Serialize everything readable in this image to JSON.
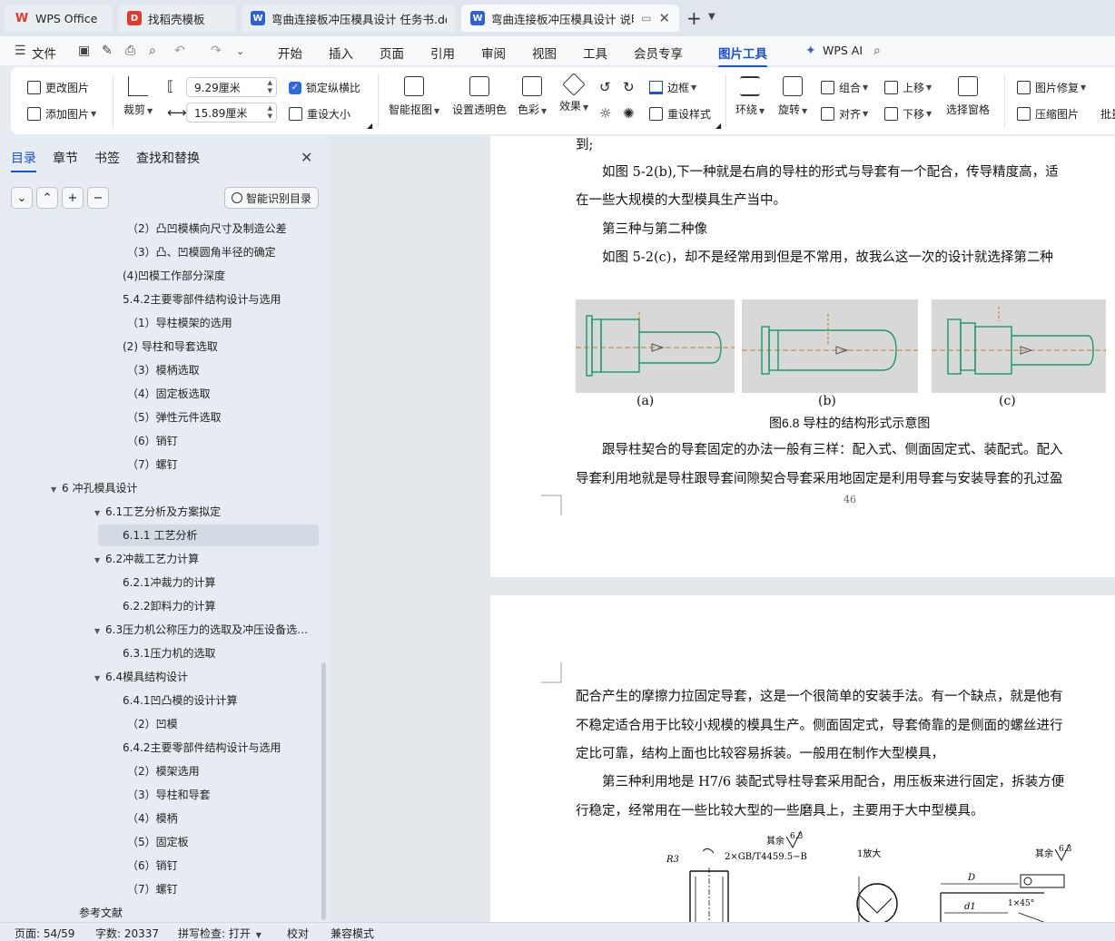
{
  "tabs": [
    {
      "label": "WPS Office",
      "icon": "wps-logo-icon"
    },
    {
      "label": "找稻壳模板",
      "icon": "template-icon"
    },
    {
      "label": "弯曲连接板冲压模具设计 任务书.doc",
      "icon": "writer-doc-icon"
    },
    {
      "label": "弯曲连接板冲压模具设计 说明",
      "icon": "writer-doc-icon"
    }
  ],
  "menu": {
    "file": "文件",
    "items": [
      "开始",
      "插入",
      "页面",
      "引用",
      "审阅",
      "视图",
      "工具",
      "会员专享",
      "图片工具"
    ],
    "active": "图片工具",
    "ai": "WPS AI"
  },
  "ribbon": {
    "change_picture": "更改图片",
    "add_picture": "添加图片",
    "crop": "裁剪",
    "height_value": "9.29厘米",
    "width_value": "15.89厘米",
    "lock_ratio": "锁定纵横比",
    "reset_size": "重设大小",
    "smart_cutout": "智能抠图",
    "set_transparent": "设置透明色",
    "color": "色彩",
    "effect": "效果",
    "border": "边框",
    "reset_style": "重设样式",
    "wrap": "环绕",
    "rotate": "旋转",
    "group": "组合",
    "align": "对齐",
    "move_up": "上移",
    "move_down": "下移",
    "selection_pane": "选择窗格",
    "picture_repair": "图片修复",
    "compress": "压缩图片",
    "batch": "批量"
  },
  "sidebar": {
    "tabs": [
      "目录",
      "章节",
      "书签",
      "查找和替换"
    ],
    "active_tab": "目录",
    "smart_toc": "智能识别目录",
    "toc": [
      {
        "text": "（2）凸凹模横向尺寸及制造公差",
        "level": 3
      },
      {
        "text": "（3）凸、凹模圆角半径的确定",
        "level": 3
      },
      {
        "text": "(4)凹模工作部分深度",
        "level": 2
      },
      {
        "text": "5.4.2主要零部件结构设计与选用",
        "level": 2
      },
      {
        "text": "（1）导柱模架的选用",
        "level": 3
      },
      {
        "text": "(2) 导柱和导套选取",
        "level": 2
      },
      {
        "text": "（3）模柄选取",
        "level": 3
      },
      {
        "text": "（4）固定板选取",
        "level": 3
      },
      {
        "text": "（5）弹性元件选取",
        "level": 3
      },
      {
        "text": "（6）销钉",
        "level": 3
      },
      {
        "text": "（7）螺钉",
        "level": 3
      },
      {
        "text": "6 冲孔模具设计",
        "level": 0,
        "expanded": true
      },
      {
        "text": "6.1工艺分析及方案拟定",
        "level": 1,
        "expanded": true
      },
      {
        "text": "6.1.1 工艺分析",
        "level": 2,
        "selected": true
      },
      {
        "text": "6.2冲裁工艺力计算",
        "level": 1,
        "expanded": true
      },
      {
        "text": "6.2.1冲裁力的计算",
        "level": 2
      },
      {
        "text": "6.2.2卸料力的计算",
        "level": 2
      },
      {
        "text": "6.3压力机公称压力的选取及冲压设备选…",
        "level": 1,
        "expanded": true
      },
      {
        "text": "6.3.1压力机的选取",
        "level": 2
      },
      {
        "text": "6.4模具结构设计",
        "level": 1,
        "expanded": true
      },
      {
        "text": "6.4.1凹凸模的设计计算",
        "level": 2
      },
      {
        "text": "（2）凹模",
        "level": 3
      },
      {
        "text": "6.4.2主要零部件结构设计与选用",
        "level": 2
      },
      {
        "text": "（2）模架选用",
        "level": 3
      },
      {
        "text": "（3）导柱和导套",
        "level": 3
      },
      {
        "text": "（4）模柄",
        "level": 3
      },
      {
        "text": "（5）固定板",
        "level": 3
      },
      {
        "text": "（6）销钉",
        "level": 3
      },
      {
        "text": "（7）螺钉",
        "level": 3
      },
      {
        "text": "参考文献",
        "level": -1
      }
    ]
  },
  "document": {
    "page1_lines": [
      "到;",
      "　　如图 5-2(b),下一种就是右肩的导柱的形式与导套有一个配合，传导精度高，适",
      "在一些大规模的大型模具生产当中。",
      "　　第三种与第二种像",
      "　　如图 5-2(c)，却不是经常用到但是不常用，故我么这一次的设计就选择第二种"
    ],
    "figure_labels": [
      "(a)",
      "(b)",
      "(c)"
    ],
    "figure_caption": "图6.8 导柱的结构形式示意图",
    "page1_after": [
      "　　跟导柱契合的导套固定的办法一般有三样：配入式、侧面固定式、装配式。配入",
      "导套利用地就是导柱跟导套间隙契合导套采用地固定是利用导套与安装导套的孔过盈"
    ],
    "page_number": "46",
    "page2_lines": [
      "配合产生的摩擦力拉固定导套，这是一个很简单的安装手法。有一个缺点，就是他有",
      "不稳定适合用于比较小规模的模具生产。侧面固定式，导套倚靠的是侧面的螺丝进行",
      "定比可靠，结构上面也比较容易拆装。一般用在制作大型模具，",
      "　　第三种利用地是 H7/6 装配式导柱导套采用配合，用压板来进行固定，拆装方便",
      "行稳定，经常用在一些比较大型的一些磨具上，主要用于大中型模具。"
    ],
    "drawing_texts": {
      "rest1": "其余",
      "rough1": "6.3",
      "r3": "R3",
      "spec": "2×GB/T4459.5−B",
      "chamfer1": "1放大",
      "rest2": "其余",
      "rough2": "6.3",
      "dim_d": "D",
      "dim_d1": "d1",
      "chamfer2": "1×45°"
    }
  },
  "status": {
    "page": "页面: 54/59",
    "words": "字数: 20337",
    "spell": "拼写检查: 打开",
    "proof": "校对",
    "compat": "兼容模式"
  }
}
